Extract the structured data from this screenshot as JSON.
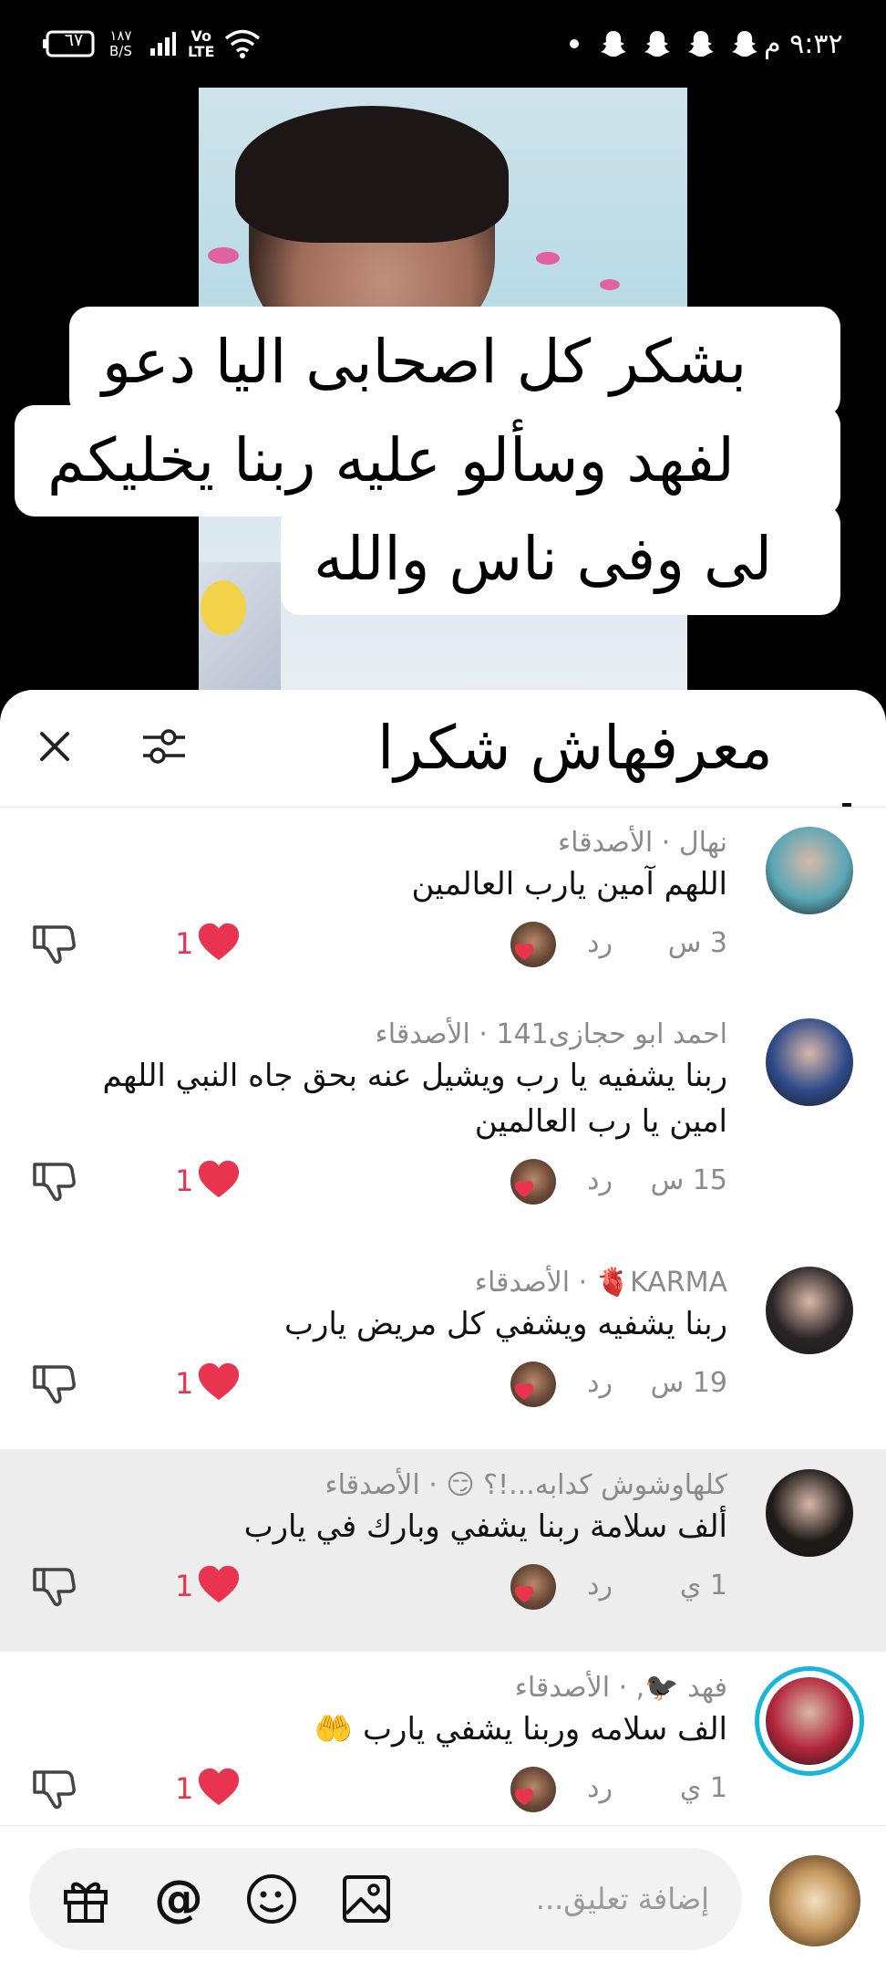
{
  "status_bar": {
    "time": "٩:٣٢ م",
    "battery": "٦٧",
    "speed_value": "١٨٧",
    "speed_unit": "B/S",
    "volte_top": "Vo",
    "volte_bottom": "LTE"
  },
  "video": {
    "caption_lines": [
      "بشكر كل اصحابى اليا دعو",
      "لفهد وسألو عليه ربنا يخليكم",
      "لى وفى ناس والله",
      "معرفهاش شكرا"
    ]
  },
  "comments": [
    {
      "name": "نهال · الأصدقاء",
      "text": [
        "اللهم آمين يارب العالمين"
      ],
      "time": "3 س",
      "reply": "رد",
      "likes": "1",
      "avatar_color": "#5aa7b5"
    },
    {
      "name": "احمد ابو حجازى141 · الأصدقاء",
      "text": [
        "ربنا يشفيه يا رب ويشيل عنه بحق جاه النبي اللهم",
        "امين يا رب العالمين"
      ],
      "time": "15 س",
      "reply": "رد",
      "likes": "1",
      "avatar_color": "#2d4a8a"
    },
    {
      "name": "KARMA🫀 · الأصدقاء",
      "text": [
        "ربنا يشفيه ويشفي كل مريض يارب"
      ],
      "time": "19 س",
      "reply": "رد",
      "likes": "1",
      "avatar_color": "#2a2426"
    },
    {
      "name": "كلهاوشوش كدابه...!؟ 😏 · الأصدقاء",
      "text": [
        "ألف سلامة ربنا يشفي وبارك في يارب"
      ],
      "time": "1 ي",
      "reply": "رد",
      "likes": "1",
      "avatar_color": "#1e1a18"
    },
    {
      "name": "فهد 🐦‍⬛, · الأصدقاء",
      "text": [
        "الف سلامه وربنا يشفي يارب 🤲"
      ],
      "time": "1 ي",
      "reply": "رد",
      "likes": "1",
      "avatar_color": "#b2243a"
    }
  ],
  "input": {
    "placeholder": "إضافة تعليق..."
  },
  "colors": {
    "like_red": "#e8344e",
    "story_ring": "#18b6d8"
  }
}
